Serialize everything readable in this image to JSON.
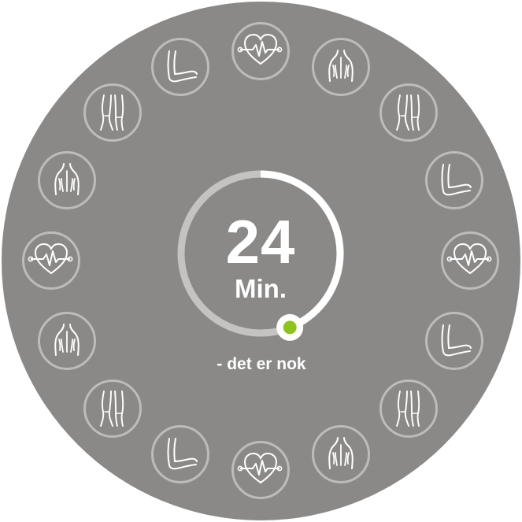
{
  "timer": {
    "value": "24",
    "unit": "Min.",
    "progress": 0.44
  },
  "tagline": "- det er nok",
  "colors": {
    "disc": "#8a8988",
    "ring_track": "#c4c3c2",
    "ring_progress": "#ffffff",
    "icon_stroke": "#ffffff",
    "icon_border": "#bdbcbb",
    "knob_accent": "#8cc31e"
  },
  "icons": [
    {
      "name": "heart-pulse-icon"
    },
    {
      "name": "back-icon"
    },
    {
      "name": "legs-icon"
    },
    {
      "name": "arm-icon"
    },
    {
      "name": "heart-pulse-icon"
    },
    {
      "name": "arm-icon"
    },
    {
      "name": "legs-icon"
    },
    {
      "name": "back-icon"
    },
    {
      "name": "heart-pulse-icon"
    },
    {
      "name": "arm-icon"
    },
    {
      "name": "legs-icon"
    },
    {
      "name": "back-icon"
    },
    {
      "name": "heart-pulse-icon"
    },
    {
      "name": "back-icon"
    },
    {
      "name": "legs-icon"
    },
    {
      "name": "arm-icon"
    }
  ]
}
